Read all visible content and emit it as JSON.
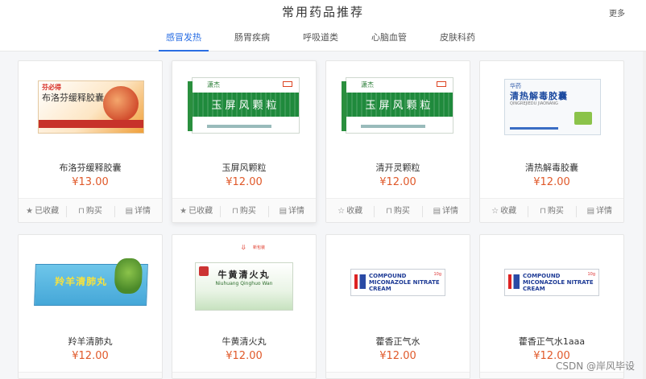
{
  "header": {
    "title": "常用药品推荐",
    "more": "更多"
  },
  "tabs": [
    "感冒发热",
    "肠胃疾病",
    "呼吸道类",
    "心脑血管",
    "皮肤科药"
  ],
  "actions": {
    "favorited": "已收藏",
    "favorite": "收藏",
    "buy": "购买",
    "detail": "详情"
  },
  "products": [
    {
      "name": "布洛芬缓释胶囊",
      "price": "¥13.00",
      "box": {
        "brand": "芬必得",
        "title": "布洛芬缓释胶囊"
      }
    },
    {
      "name": "玉屏风颗粒",
      "price": "¥12.00",
      "box": {
        "brand": "潇杰",
        "title": "玉屏风颗粒"
      }
    },
    {
      "name": "清开灵颗粒",
      "price": "¥12.00",
      "box": {
        "brand": "潇杰",
        "title": "玉屏风颗粒"
      }
    },
    {
      "name": "清热解毒胶囊",
      "price": "¥12.00",
      "box": {
        "brand": "华药",
        "title": "清热解毒胶囊",
        "en": "QINGREJIEDU JIAONANG"
      }
    },
    {
      "name": "羚羊清肺丸",
      "price": "¥12.00",
      "box": {
        "title": "羚羊清肺丸"
      }
    },
    {
      "name": "牛黄清火丸",
      "price": "¥12.00",
      "box": {
        "tag": "新包装",
        "title": "牛黄清火丸",
        "en": "Niuhuang Qinghuo Wan"
      }
    },
    {
      "name": "藿香正气水",
      "price": "¥12.00",
      "box": {
        "line1": "COMPOUND",
        "line2": "MICONAZOLE NITRATE",
        "line3": "CREAM",
        "tag": "10g"
      }
    },
    {
      "name": "藿香正气水1aaa",
      "price": "¥12.00",
      "box": {
        "line1": "COMPOUND",
        "line2": "MICONAZOLE NITRATE",
        "line3": "CREAM",
        "tag": "10g"
      }
    }
  ],
  "watermark": "CSDN @岸风毕设",
  "colors": {
    "accent": "#2a6ee3",
    "price": "#e0592a"
  }
}
